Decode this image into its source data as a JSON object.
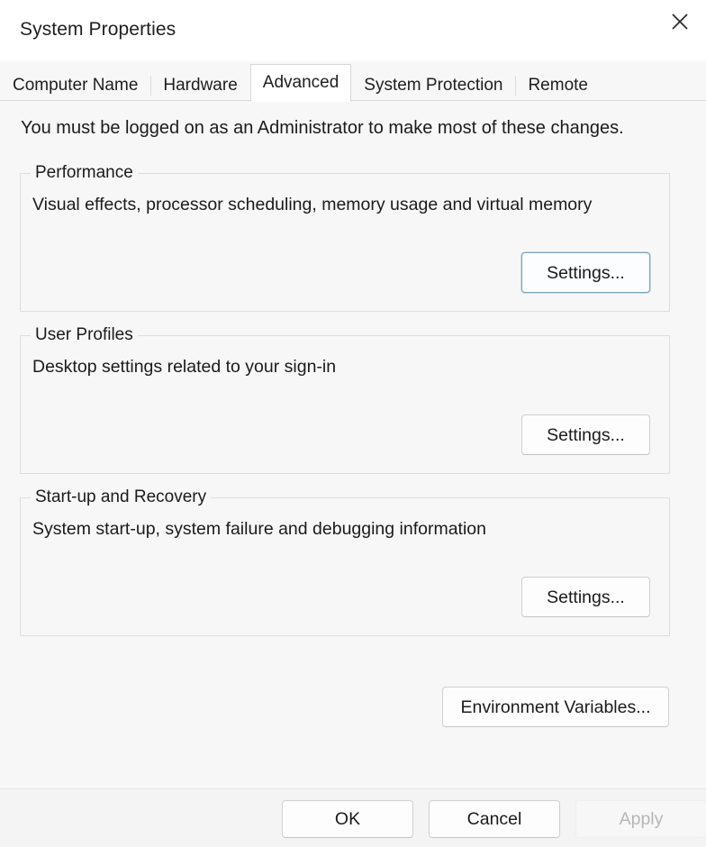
{
  "window": {
    "title": "System Properties",
    "close_icon": "close-icon"
  },
  "tabs": [
    {
      "label": "Computer Name",
      "active": false
    },
    {
      "label": "Hardware",
      "active": false
    },
    {
      "label": "Advanced",
      "active": true
    },
    {
      "label": "System Protection",
      "active": false
    },
    {
      "label": "Remote",
      "active": false
    }
  ],
  "content": {
    "intro": "You must be logged on as an Administrator to make most of these changes.",
    "groups": [
      {
        "legend": "Performance",
        "description": "Visual effects, processor scheduling, memory usage and virtual memory",
        "button_label": "Settings...",
        "button_focused": true
      },
      {
        "legend": "User Profiles",
        "description": "Desktop settings related to your sign-in",
        "button_label": "Settings...",
        "button_focused": false
      },
      {
        "legend": "Start-up and Recovery",
        "description": "System start-up, system failure and debugging information",
        "button_label": "Settings...",
        "button_focused": false
      }
    ],
    "environment_variables_label": "Environment Variables..."
  },
  "footer": {
    "ok_label": "OK",
    "cancel_label": "Cancel",
    "apply_label": "Apply",
    "apply_disabled": true
  },
  "colors": {
    "dialog_background": "#f7f7f7",
    "titlebar_background": "#ffffff",
    "group_border": "#dedede",
    "focus_accent": "#7ba2b8",
    "text": "#1b1b1b",
    "disabled_text": "#b6b6b6"
  }
}
